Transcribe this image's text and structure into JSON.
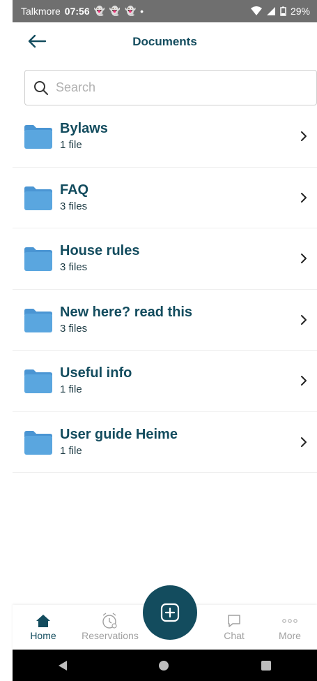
{
  "status": {
    "carrier": "Talkmore",
    "time": "07:56",
    "battery": "29%"
  },
  "header": {
    "title": "Documents"
  },
  "search": {
    "placeholder": "Search"
  },
  "folders": [
    {
      "name": "Bylaws",
      "count": "1 file"
    },
    {
      "name": "FAQ",
      "count": "3 files"
    },
    {
      "name": "House rules",
      "count": "3 files"
    },
    {
      "name": "New here? read this",
      "count": "3 files"
    },
    {
      "name": "Useful info",
      "count": "1 file"
    },
    {
      "name": "User guide Heime",
      "count": "1 file"
    }
  ],
  "nav": {
    "home": "Home",
    "reservations": "Reservations",
    "chat": "Chat",
    "more": "More"
  },
  "colors": {
    "accent": "#134c5e",
    "folder": "#5aa6df"
  }
}
